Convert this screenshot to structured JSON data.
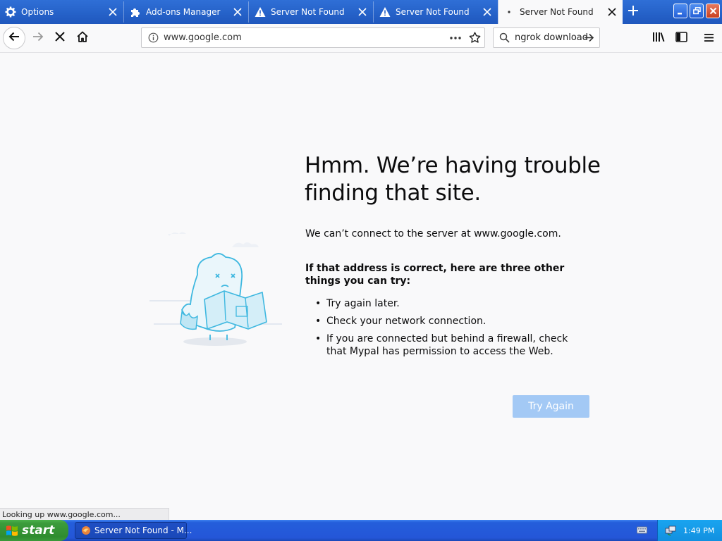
{
  "tabs": [
    {
      "label": "Options",
      "icon": "gear-icon",
      "active": false
    },
    {
      "label": "Add-ons Manager",
      "icon": "puzzle-icon",
      "active": false
    },
    {
      "label": "Server Not Found",
      "icon": "warning-icon",
      "active": false
    },
    {
      "label": "Server Not Found",
      "icon": "warning-icon",
      "active": false
    },
    {
      "label": "Server Not Found",
      "icon": "loading-dot-icon",
      "active": true
    }
  ],
  "urlbar": {
    "value": "www.google.com"
  },
  "searchbar": {
    "value": "ngrok download"
  },
  "error": {
    "title": "Hmm. We’re having trouble finding that site.",
    "intro": "We can’t connect to the server at www.google.com.",
    "suggestions_heading": "If that address is correct, here are three other things you can try:",
    "suggestions": [
      "Try again later.",
      "Check your network connection.",
      "If you are connected but behind a firewall, check that Mypal has permission to access the Web."
    ],
    "try_again_label": "Try Again"
  },
  "status_text": "Looking up www.google.com...",
  "taskbar": {
    "start_label": "start",
    "task_label": "Server Not Found - M...",
    "clock": "1:49 PM"
  },
  "colors": {
    "tabstrip": "#2561c8",
    "try_again": "#a3c9f5",
    "illustration": "#3fb8e0",
    "start_green": "#3c9c3c"
  }
}
